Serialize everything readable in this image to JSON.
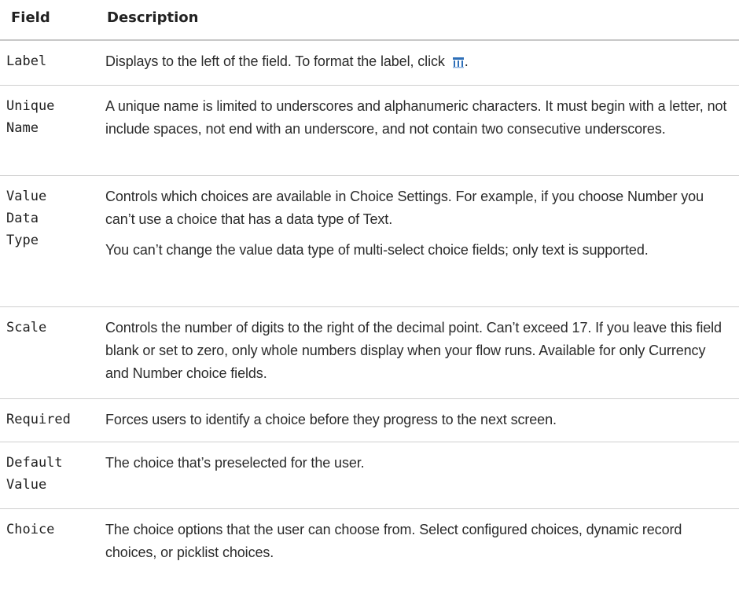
{
  "header": {
    "field": "Field",
    "description": "Description"
  },
  "rows": [
    {
      "field": "Label",
      "desc": "Displays to the left of the field. To format the label, click",
      "desc_end": ".",
      "icon": "format-text-icon"
    },
    {
      "field": "Unique\nName",
      "desc": "A unique name is limited to underscores and alphanumeric characters. It must begin with a letter, not include spaces, not end with an underscore, and not contain two consecutive underscores."
    },
    {
      "field": "Value\nData\nType",
      "desc": "Controls which choices are available in Choice Settings. For example, if you choose Number you can’t use a choice that has a data type of Text.",
      "desc2": "You can’t change the value data type of multi-select choice fields; only text is supported."
    },
    {
      "field": "Scale",
      "desc": "Controls the number of digits to the right of the decimal point. Can’t exceed 17. If you leave this field blank or set to zero, only whole numbers display when your flow runs. Available for only Currency and Number choice fields."
    },
    {
      "field": "Required",
      "desc": "Forces users to identify a choice before they progress to the next screen."
    },
    {
      "field": "Default\nValue",
      "desc": "The choice that’s preselected for the user."
    },
    {
      "field": "Choice",
      "desc": "The choice options that the user can choose from. Select configured choices, dynamic record choices, or picklist choices."
    }
  ],
  "colors": {
    "border": "#cfcfcf",
    "text": "#2b2b2b",
    "icon_blue": "#2e6fb8"
  }
}
